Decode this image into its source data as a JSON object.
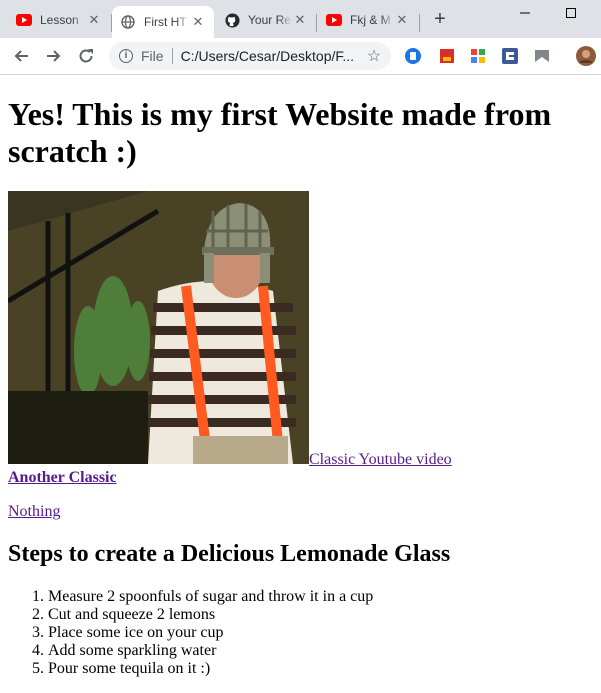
{
  "tabs": [
    {
      "title": "Lesson",
      "icon": "youtube-icon",
      "active": false
    },
    {
      "title": "First HT",
      "icon": "globe-icon",
      "active": true
    },
    {
      "title": "Your Re",
      "icon": "github-icon",
      "active": false
    },
    {
      "title": "Fkj & M",
      "icon": "youtube-icon",
      "active": false
    }
  ],
  "omnibox": {
    "scheme": "File",
    "url": "C:/Users/Cesar/Desktop/F..."
  },
  "page": {
    "heading": "Yes! This is my first Website made from scratch :)",
    "photo_alt": "El Chavo character photo",
    "link_video": "Classic Youtube video",
    "link_classic": "Another Classic",
    "link_nothing": "Nothing",
    "subheading": "Steps to create a Delicious Lemonade Glass",
    "steps": [
      "Measure 2 spoonfuls of sugar and throw it in a cup",
      "Cut and squeeze 2 lemons",
      "Place some ice on your cup",
      "Add some sparkling water",
      "Pour some tequila on it :)"
    ]
  },
  "colors": {
    "visited_link": "#551a8b",
    "chrome_bg": "#dee1e6",
    "youtube_red": "#ff0000"
  }
}
